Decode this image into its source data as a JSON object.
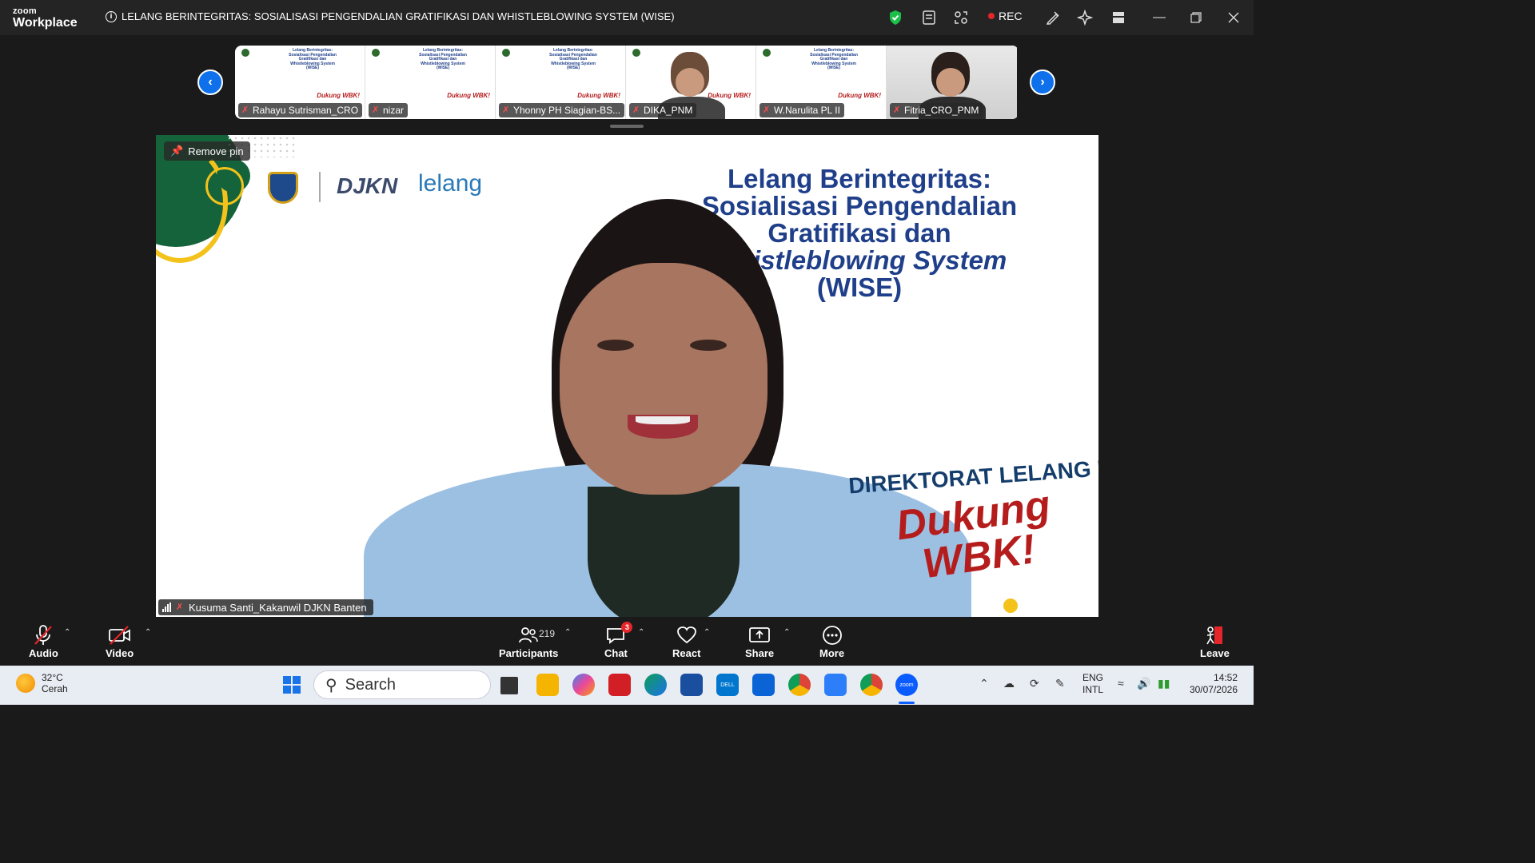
{
  "titlebar": {
    "brand_small": "zoom",
    "brand_large": "Workplace",
    "meeting_title": "LELANG BERINTEGRITAS: SOSIALISASI PENGENDALIAN GRATIFIKASI DAN WHISTLEBLOWING SYSTEM (WISE)",
    "rec_label": "REC"
  },
  "thumbnails": [
    {
      "name": "Rahayu Sutrisman_CRO",
      "type": "slide"
    },
    {
      "name": "nizar",
      "type": "slide"
    },
    {
      "name": "Yhonny PH Siagian-BS...",
      "type": "slide"
    },
    {
      "name": "DIKA_PNM",
      "type": "person"
    },
    {
      "name": "W.Narulita PL II",
      "type": "slide"
    },
    {
      "name": "Fitria_CRO_PNM",
      "type": "person"
    }
  ],
  "main_video": {
    "pin_label": "Remove pin",
    "logo_djkn": "DJKN",
    "logo_lelang": "lelang",
    "slide_title_lines": [
      "Lelang Berintegritas:",
      "Sosialisasi Pengendalian",
      "Gratifikasi dan",
      "Whistleblowing System",
      "(WISE)"
    ],
    "direktorat": "DIREKTORAT LELANG DJKN",
    "dukung": "Dukung WBK!",
    "speaker_name": "Kusuma Santi_Kakanwil DJKN Banten"
  },
  "controls": {
    "audio": "Audio",
    "video": "Video",
    "participants": "Participants",
    "participants_count": "219",
    "chat": "Chat",
    "chat_badge": "3",
    "react": "React",
    "share": "Share",
    "more": "More",
    "leave": "Leave"
  },
  "taskbar": {
    "temp": "32°C",
    "weather": "Cerah",
    "search_placeholder": "Search",
    "lang1": "ENG",
    "lang2": "INTL",
    "time": "14:52",
    "date": "30/07/2026"
  },
  "colors": {
    "accent": "#0e71eb",
    "rec": "#e5252a",
    "slide_blue": "#1f3f8a",
    "slide_red": "#b51c1c",
    "slide_green": "#15633a"
  }
}
